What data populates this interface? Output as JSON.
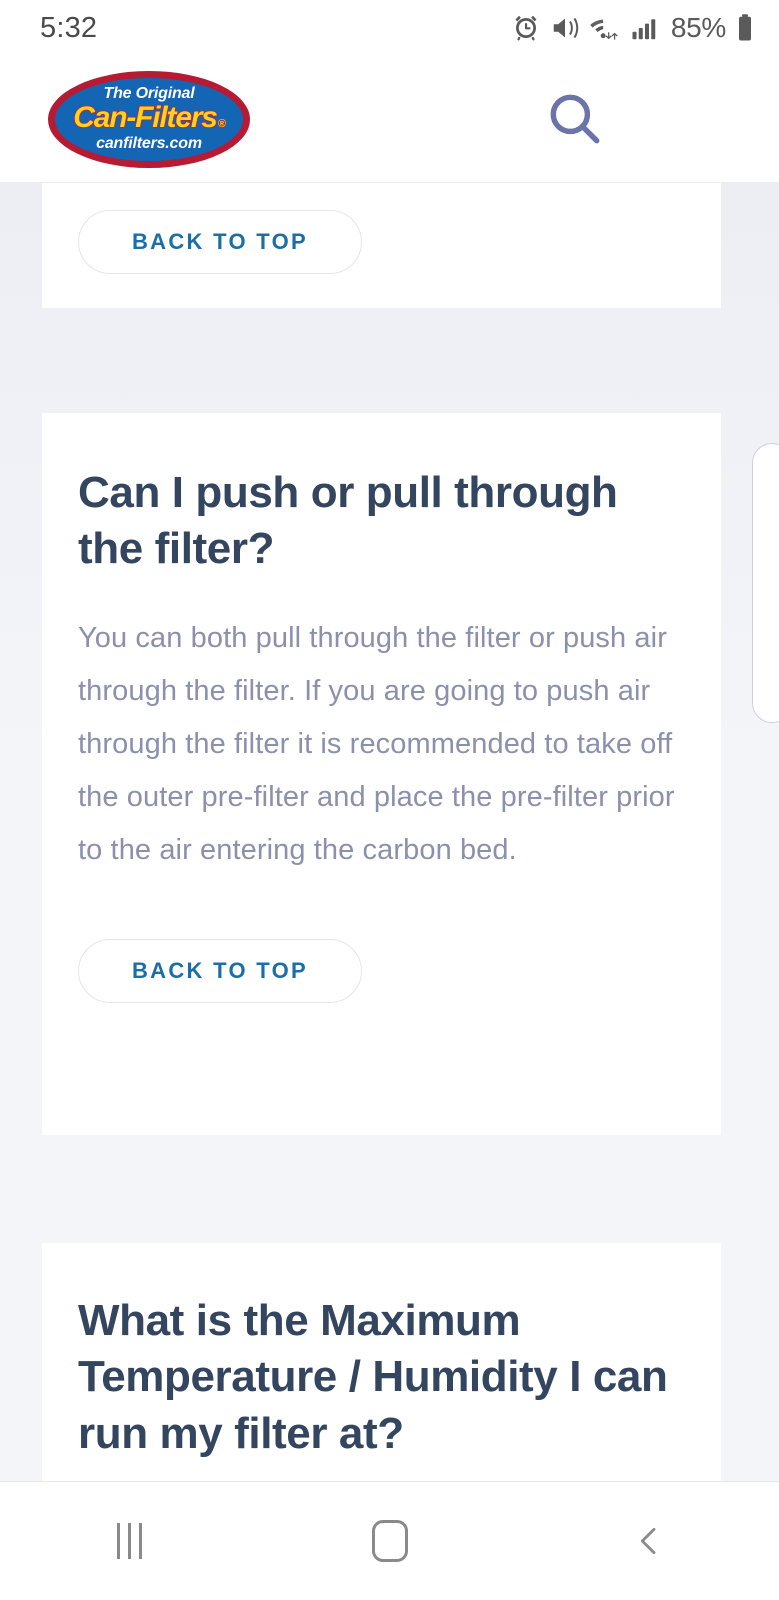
{
  "status_bar": {
    "time": "5:32",
    "battery_percent": "85%",
    "icons": [
      "alarm-icon",
      "vibrate-icon",
      "wifi-icon",
      "cellular-signal-icon",
      "battery-icon"
    ]
  },
  "header": {
    "logo": {
      "tagline": "The Original",
      "brand": "Can-Filters",
      "registered_mark": "®",
      "website": "canfilters.com",
      "oval_fill": "#1565b5",
      "oval_border": "#b61b33",
      "brand_color": "#ffd21e"
    },
    "search_label": "search-icon",
    "menu_label": "hamburger-menu-icon",
    "icon_color": "#6a74a8"
  },
  "theme": {
    "page_background": "#f4f5f9",
    "card_background": "#ffffff",
    "heading_color": "#33455f",
    "body_color": "#8b90ad",
    "link_color": "#1b6fa8",
    "button_border": "#e6e6e6"
  },
  "faq_cards": [
    {
      "id": "card-1",
      "title": "",
      "body": "",
      "button_label": "BACK TO TOP"
    },
    {
      "id": "card-2",
      "title": "Can I push or pull through the filter?",
      "body": "You can both pull through the filter or push air through the filter. If you are going to push air through the filter it is recommended to take off the outer pre-filter and place the pre-filter prior to the air entering the carbon bed.",
      "button_label": "BACK TO TOP"
    },
    {
      "id": "card-3",
      "title": "What is the Maximum Temperature / Humidity I can run my filter at?",
      "body": "",
      "button_label": ""
    }
  ],
  "nav_bar": {
    "recents_label": "recents-icon",
    "home_label": "home-icon",
    "back_label": "back-icon",
    "icon_color": "#8a8a8a"
  }
}
